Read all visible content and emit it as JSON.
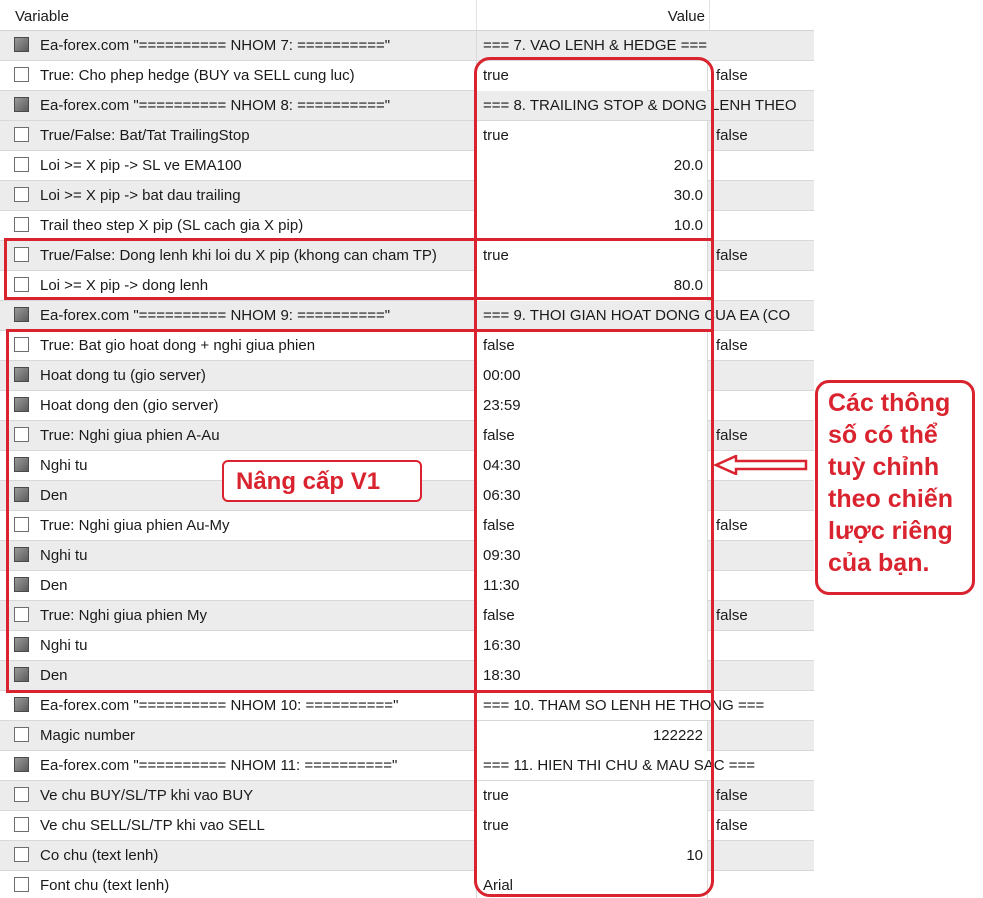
{
  "header": {
    "variable": "Variable",
    "value": "Value"
  },
  "rows": [
    {
      "name": "Ea-forex.com    \"========== NHOM 7: ==========\"",
      "value": "=== 7. VAO LENH & HEDGE ===",
      "align": "left",
      "alt": "",
      "gray": true,
      "dark": true,
      "group": true
    },
    {
      "name": "True: Cho phep hedge (BUY va SELL cung luc)",
      "value": "true",
      "align": "left",
      "alt": "false",
      "gray": false,
      "dark": false,
      "group": false
    },
    {
      "name": "Ea-forex.com    \"========== NHOM 8: ==========\"",
      "value": "=== 8. TRAILING STOP & DONG LENH THEO",
      "align": "left",
      "alt": "",
      "gray": true,
      "dark": true,
      "group": true
    },
    {
      "name": "True/False: Bat/Tat TrailingStop",
      "value": "true",
      "align": "left",
      "alt": "false",
      "gray": true,
      "dark": false,
      "group": false
    },
    {
      "name": "Loi >= X pip -> SL ve EMA100",
      "value": "20.0",
      "align": "right",
      "alt": "",
      "gray": false,
      "dark": false,
      "group": false
    },
    {
      "name": "Loi >= X pip -> bat dau trailing",
      "value": "30.0",
      "align": "right",
      "alt": "",
      "gray": true,
      "dark": false,
      "group": false
    },
    {
      "name": "Trail theo step X pip (SL cach gia X pip)",
      "value": "10.0",
      "align": "right",
      "alt": "",
      "gray": false,
      "dark": false,
      "group": false
    },
    {
      "name": "True/False: Dong lenh khi loi du X pip (khong can cham TP)",
      "value": "true",
      "align": "left",
      "alt": "false",
      "gray": true,
      "dark": false,
      "group": false
    },
    {
      "name": "Loi >= X pip -> dong lenh",
      "value": "80.0",
      "align": "right",
      "alt": "",
      "gray": false,
      "dark": false,
      "group": false
    },
    {
      "name": "Ea-forex.com    \"========== NHOM 9: ==========\"",
      "value": "=== 9. THOI GIAN HOAT DONG CUA EA (CO",
      "align": "left",
      "alt": "",
      "gray": true,
      "dark": true,
      "group": true
    },
    {
      "name": "True: Bat gio hoat dong + nghi giua phien",
      "value": "false",
      "align": "left",
      "alt": "false",
      "gray": false,
      "dark": false,
      "group": false
    },
    {
      "name": "Hoat dong tu (gio server)",
      "value": "00:00",
      "align": "left",
      "alt": "",
      "gray": true,
      "dark": true,
      "group": false
    },
    {
      "name": "Hoat dong den (gio server)",
      "value": "23:59",
      "align": "left",
      "alt": "",
      "gray": false,
      "dark": true,
      "group": false
    },
    {
      "name": "True: Nghi giua phien A-Au",
      "value": "false",
      "align": "left",
      "alt": "false",
      "gray": true,
      "dark": false,
      "group": false
    },
    {
      "name": "Nghi tu",
      "value": "04:30",
      "align": "left",
      "alt": "",
      "gray": false,
      "dark": true,
      "group": false
    },
    {
      "name": "Den",
      "value": "06:30",
      "align": "left",
      "alt": "",
      "gray": true,
      "dark": true,
      "group": false
    },
    {
      "name": "True: Nghi giua phien Au-My",
      "value": "false",
      "align": "left",
      "alt": "false",
      "gray": false,
      "dark": false,
      "group": false
    },
    {
      "name": "Nghi tu",
      "value": "09:30",
      "align": "left",
      "alt": "",
      "gray": true,
      "dark": true,
      "group": false
    },
    {
      "name": "Den",
      "value": "11:30",
      "align": "left",
      "alt": "",
      "gray": false,
      "dark": true,
      "group": false
    },
    {
      "name": "True: Nghi giua phien My",
      "value": "false",
      "align": "left",
      "alt": "false",
      "gray": true,
      "dark": false,
      "group": false
    },
    {
      "name": "Nghi tu",
      "value": "16:30",
      "align": "left",
      "alt": "",
      "gray": false,
      "dark": true,
      "group": false
    },
    {
      "name": "Den",
      "value": "18:30",
      "align": "left",
      "alt": "",
      "gray": true,
      "dark": true,
      "group": false
    },
    {
      "name": "Ea-forex.com    \"========== NHOM 10: ==========\"",
      "value": "=== 10. THAM SO LENH HE THONG ===",
      "align": "left",
      "alt": "",
      "gray": false,
      "dark": true,
      "group": true
    },
    {
      "name": "Magic number",
      "value": "122222",
      "align": "right",
      "alt": "",
      "gray": true,
      "dark": false,
      "group": false
    },
    {
      "name": "Ea-forex.com    \"========== NHOM 11: ==========\"",
      "value": "=== 11. HIEN THI CHU & MAU SAC ===",
      "align": "left",
      "alt": "",
      "gray": false,
      "dark": true,
      "group": true
    },
    {
      "name": "Ve chu BUY/SL/TP khi vao BUY",
      "value": "true",
      "align": "left",
      "alt": "false",
      "gray": true,
      "dark": false,
      "group": false
    },
    {
      "name": "Ve chu SELL/SL/TP khi vao SELL",
      "value": "true",
      "align": "left",
      "alt": "false",
      "gray": false,
      "dark": false,
      "group": false
    },
    {
      "name": "Co chu (text lenh)",
      "value": "10",
      "align": "right",
      "alt": "",
      "gray": true,
      "dark": false,
      "group": false
    },
    {
      "name": "Font chu (text lenh)",
      "value": "Arial",
      "align": "left",
      "alt": "",
      "gray": false,
      "dark": false,
      "group": false
    }
  ],
  "annotations": {
    "upgrade_label": "Nâng cấp V1",
    "note_lines": [
      "Các thông",
      "số có thể",
      "tuỳ chỉnh",
      "theo chiến",
      "lược riêng",
      "của bạn."
    ]
  },
  "colors": {
    "annotation_red": "#d9232e",
    "row_gray": "#ececec"
  }
}
